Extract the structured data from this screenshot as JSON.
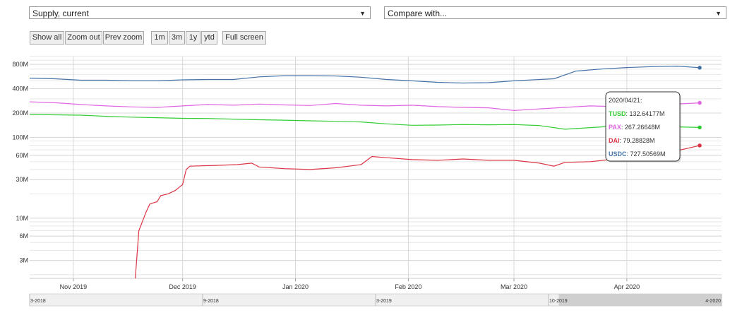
{
  "controls": {
    "metric_select": "Supply, current",
    "compare_select": "Compare with...",
    "dropdown_arrow": "▼",
    "buttons": [
      "Show all",
      "Zoom out",
      "Prev zoom",
      "1m",
      "3m",
      "1y",
      "ytd",
      "Full screen"
    ]
  },
  "chart_data": {
    "type": "line",
    "y_scale": "log",
    "ylim": [
      1800000,
      1000000000
    ],
    "y_ticks": [
      {
        "value": 3000000,
        "label": "3M"
      },
      {
        "value": 6000000,
        "label": "6M"
      },
      {
        "value": 10000000,
        "label": "10M"
      },
      {
        "value": 30000000,
        "label": "30M"
      },
      {
        "value": 60000000,
        "label": "60M"
      },
      {
        "value": 100000000,
        "label": "100M"
      },
      {
        "value": 200000000,
        "label": "200M"
      },
      {
        "value": 400000000,
        "label": "400M"
      },
      {
        "value": 800000000,
        "label": "800M"
      }
    ],
    "x_range": [
      "2019-10-20",
      "2020-04-27"
    ],
    "x_ticks": [
      {
        "date": "2019-11-01",
        "label": "Nov 2019"
      },
      {
        "date": "2019-12-01",
        "label": "Dec 2019"
      },
      {
        "date": "2020-01-01",
        "label": "Jan 2020"
      },
      {
        "date": "2020-02-01",
        "label": "Feb 2020"
      },
      {
        "date": "2020-03-01",
        "label": "Mar 2020"
      },
      {
        "date": "2020-04-01",
        "label": "Apr 2020"
      }
    ],
    "navigator": {
      "labels": [
        "3-2018",
        "9-2018",
        "3-2019",
        "10-2019",
        "4-2020"
      ],
      "range": [
        "2018-03-01",
        "2020-04-21"
      ],
      "selected": [
        "2019-10-20",
        "2020-04-21"
      ]
    },
    "series": [
      {
        "name": "USDC",
        "color": "#4572a7",
        "points": [
          [
            "2019-10-20",
            540000000
          ],
          [
            "2019-10-27",
            530000000
          ],
          [
            "2019-11-03",
            510000000
          ],
          [
            "2019-11-10",
            510000000
          ],
          [
            "2019-11-17",
            500000000
          ],
          [
            "2019-11-24",
            500000000
          ],
          [
            "2019-12-01",
            515000000
          ],
          [
            "2019-12-08",
            520000000
          ],
          [
            "2019-12-15",
            520000000
          ],
          [
            "2019-12-22",
            560000000
          ],
          [
            "2019-12-29",
            580000000
          ],
          [
            "2020-01-05",
            580000000
          ],
          [
            "2020-01-12",
            575000000
          ],
          [
            "2020-01-19",
            555000000
          ],
          [
            "2020-01-26",
            520000000
          ],
          [
            "2020-02-02",
            500000000
          ],
          [
            "2020-02-09",
            480000000
          ],
          [
            "2020-02-16",
            470000000
          ],
          [
            "2020-02-23",
            475000000
          ],
          [
            "2020-03-01",
            500000000
          ],
          [
            "2020-03-08",
            520000000
          ],
          [
            "2020-03-12",
            530000000
          ],
          [
            "2020-03-18",
            660000000
          ],
          [
            "2020-03-25",
            700000000
          ],
          [
            "2020-04-01",
            730000000
          ],
          [
            "2020-04-08",
            750000000
          ],
          [
            "2020-04-15",
            760000000
          ],
          [
            "2020-04-21",
            727505690
          ]
        ]
      },
      {
        "name": "PAX",
        "color": "#e066e0",
        "points": [
          [
            "2019-10-20",
            275000000
          ],
          [
            "2019-10-27",
            268000000
          ],
          [
            "2019-11-03",
            255000000
          ],
          [
            "2019-11-10",
            245000000
          ],
          [
            "2019-11-17",
            238000000
          ],
          [
            "2019-11-24",
            235000000
          ],
          [
            "2019-12-01",
            245000000
          ],
          [
            "2019-12-08",
            255000000
          ],
          [
            "2019-12-15",
            250000000
          ],
          [
            "2019-12-22",
            258000000
          ],
          [
            "2019-12-29",
            252000000
          ],
          [
            "2020-01-05",
            248000000
          ],
          [
            "2020-01-12",
            262000000
          ],
          [
            "2020-01-19",
            250000000
          ],
          [
            "2020-01-26",
            245000000
          ],
          [
            "2020-02-02",
            250000000
          ],
          [
            "2020-02-09",
            240000000
          ],
          [
            "2020-02-16",
            235000000
          ],
          [
            "2020-02-23",
            232000000
          ],
          [
            "2020-03-01",
            215000000
          ],
          [
            "2020-03-08",
            225000000
          ],
          [
            "2020-03-15",
            235000000
          ],
          [
            "2020-03-22",
            245000000
          ],
          [
            "2020-03-29",
            240000000
          ],
          [
            "2020-04-05",
            245000000
          ],
          [
            "2020-04-12",
            255000000
          ],
          [
            "2020-04-21",
            267266480
          ]
        ]
      },
      {
        "name": "TUSD",
        "color": "#33cc33",
        "points": [
          [
            "2019-10-20",
            192000000
          ],
          [
            "2019-10-27",
            190000000
          ],
          [
            "2019-11-03",
            188000000
          ],
          [
            "2019-11-10",
            182000000
          ],
          [
            "2019-11-17",
            178000000
          ],
          [
            "2019-11-24",
            175000000
          ],
          [
            "2019-12-01",
            172000000
          ],
          [
            "2019-12-08",
            171000000
          ],
          [
            "2019-12-15",
            168000000
          ],
          [
            "2019-12-22",
            165000000
          ],
          [
            "2019-12-29",
            163000000
          ],
          [
            "2020-01-05",
            160000000
          ],
          [
            "2020-01-12",
            158000000
          ],
          [
            "2020-01-19",
            155000000
          ],
          [
            "2020-01-26",
            147000000
          ],
          [
            "2020-02-02",
            141000000
          ],
          [
            "2020-02-09",
            142000000
          ],
          [
            "2020-02-16",
            144000000
          ],
          [
            "2020-02-23",
            143000000
          ],
          [
            "2020-03-01",
            144000000
          ],
          [
            "2020-03-08",
            140000000
          ],
          [
            "2020-03-15",
            126000000
          ],
          [
            "2020-03-22",
            132000000
          ],
          [
            "2020-03-29",
            138000000
          ],
          [
            "2020-04-05",
            137000000
          ],
          [
            "2020-04-12",
            136000000
          ],
          [
            "2020-04-21",
            132641770
          ]
        ]
      },
      {
        "name": "DAI",
        "color": "#dc3545",
        "points": [
          [
            "2019-11-18",
            1000000
          ],
          [
            "2019-11-19",
            7000000
          ],
          [
            "2019-11-21",
            12000000
          ],
          [
            "2019-11-22",
            15000000
          ],
          [
            "2019-11-24",
            16000000
          ],
          [
            "2019-11-25",
            19000000
          ],
          [
            "2019-11-27",
            20000000
          ],
          [
            "2019-11-29",
            22000000
          ],
          [
            "2019-11-30",
            24000000
          ],
          [
            "2019-12-01",
            26000000
          ],
          [
            "2019-12-02",
            40000000
          ],
          [
            "2019-12-03",
            44000000
          ],
          [
            "2019-12-10",
            45000000
          ],
          [
            "2019-12-16",
            46000000
          ],
          [
            "2019-12-20",
            48000000
          ],
          [
            "2019-12-22",
            43000000
          ],
          [
            "2019-12-29",
            41000000
          ],
          [
            "2020-01-05",
            40000000
          ],
          [
            "2020-01-12",
            42000000
          ],
          [
            "2020-01-19",
            46000000
          ],
          [
            "2020-01-22",
            58000000
          ],
          [
            "2020-01-26",
            56000000
          ],
          [
            "2020-02-02",
            53000000
          ],
          [
            "2020-02-09",
            52000000
          ],
          [
            "2020-02-16",
            54000000
          ],
          [
            "2020-02-23",
            52000000
          ],
          [
            "2020-03-01",
            52000000
          ],
          [
            "2020-03-08",
            48000000
          ],
          [
            "2020-03-12",
            44000000
          ],
          [
            "2020-03-15",
            49000000
          ],
          [
            "2020-03-22",
            50000000
          ],
          [
            "2020-03-29",
            54000000
          ],
          [
            "2020-04-05",
            58000000
          ],
          [
            "2020-04-12",
            64000000
          ],
          [
            "2020-04-21",
            79288280
          ]
        ]
      }
    ],
    "tooltip": {
      "date": "2020/04/21:",
      "rows": [
        {
          "name": "TUSD",
          "value": "132.64177M",
          "color": "#33cc33"
        },
        {
          "name": "PAX",
          "value": "267.26648M",
          "color": "#e066e0"
        },
        {
          "name": "DAI",
          "value": "79.28828M",
          "color": "#dc3545"
        },
        {
          "name": "USDC",
          "value": "727.50569M",
          "color": "#4572a7"
        }
      ]
    }
  }
}
